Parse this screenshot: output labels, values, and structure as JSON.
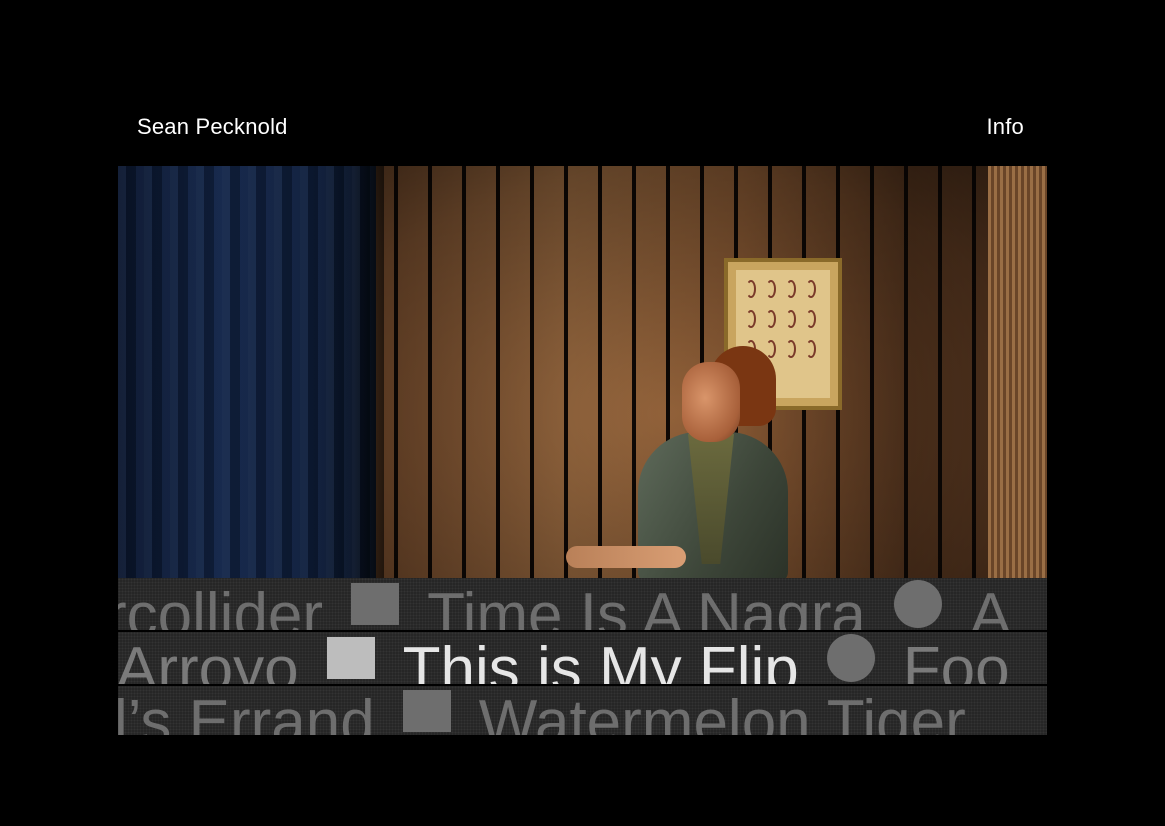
{
  "header": {
    "site_title": "Sean Pecknold",
    "info_link": "Info"
  },
  "hero": {
    "media": "film-still"
  },
  "marquee": {
    "row1": [
      "rcollider",
      "Time Is A Nagra",
      "A"
    ],
    "row2": [
      "Arroyo",
      "This is My Flip",
      "Foo"
    ],
    "row3": [
      "l’s Errand",
      "Watermelon Tiger"
    ],
    "active_title": "This is My Flip"
  },
  "colors": {
    "background": "#000000",
    "text": "#ffffff",
    "marquee_text": "#6e6e6e",
    "marquee_active": "#e6e6e6"
  }
}
